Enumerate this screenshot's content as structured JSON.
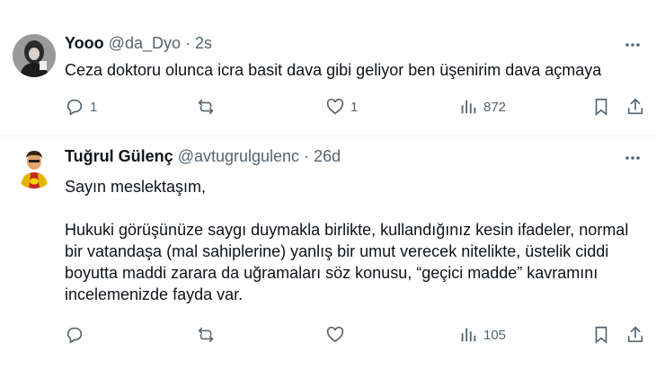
{
  "tweets": [
    {
      "display_name": "Yooo",
      "handle": "@da_Dyo",
      "separator": "·",
      "time": "2s",
      "paragraphs": [
        "Ceza doktoru olunca icra basit dava gibi geliyor ben üşenirim dava açmaya"
      ],
      "replies": "1",
      "retweets": "",
      "likes": "1",
      "views": "872"
    },
    {
      "display_name": "Tuğrul Gülenç",
      "handle": "@avtugrulgulenc",
      "separator": "·",
      "time": "26d",
      "paragraphs": [
        "Sayın meslektaşım,",
        "Hukuki görüşünüze saygı duymakla birlikte, kullandığınız kesin ifadeler, normal bir vatandaşa (mal sahiplerine) yanlış bir umut verecek nitelikte, üstelik ciddi boyutta maddi zarara da uğramaları söz konusu,  “geçici madde” kavramını incelemenizde fayda var."
      ],
      "replies": "",
      "retweets": "",
      "likes": "",
      "views": "105"
    }
  ],
  "icons": {
    "reply": "reply-icon",
    "retweet": "retweet-icon",
    "like": "like-icon",
    "views": "views-icon",
    "bookmark": "bookmark-icon",
    "share": "share-icon",
    "more": "more-icon"
  },
  "colors": {
    "text": "#0f1419",
    "secondary": "#536471",
    "divider": "#eff3f4"
  }
}
